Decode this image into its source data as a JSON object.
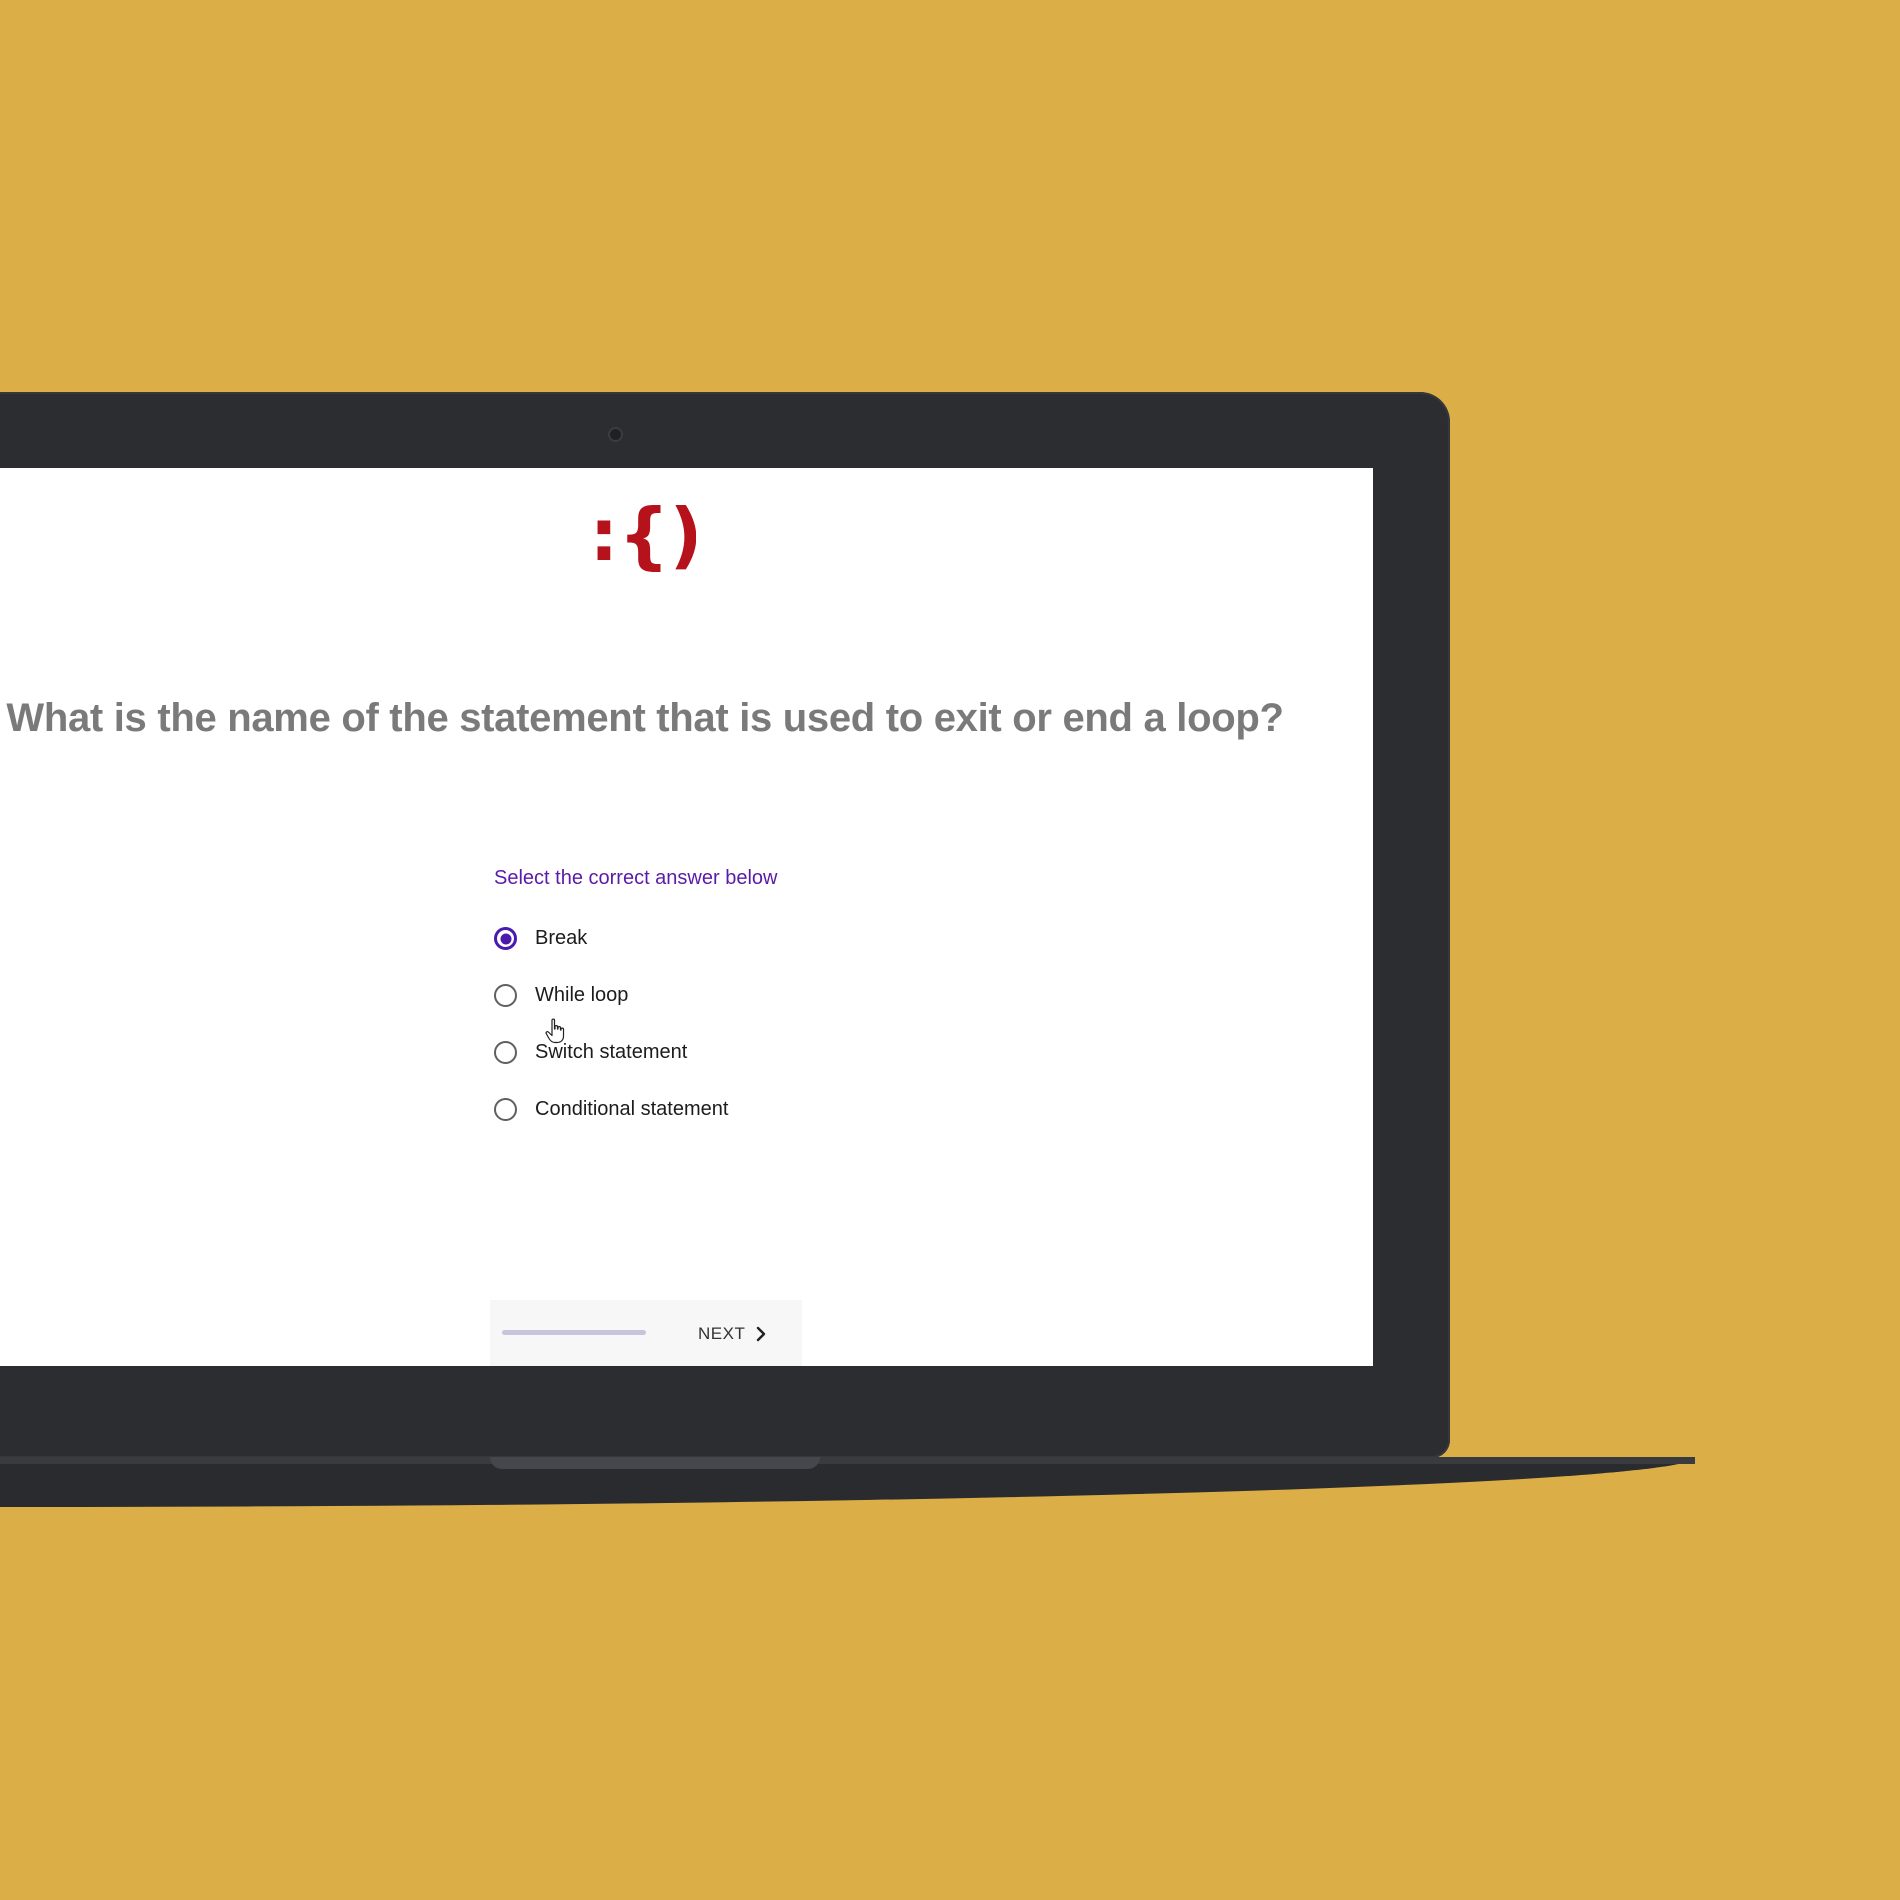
{
  "logo": {
    "text": ":{)",
    "color": "#b5121b"
  },
  "question": {
    "text": "What is the name of the statement that is used to exit or end a loop?"
  },
  "answers": {
    "prompt": "Select the correct answer below",
    "options": [
      {
        "label": "Break",
        "selected": true
      },
      {
        "label": "While loop",
        "selected": false
      },
      {
        "label": "Switch statement",
        "selected": false
      },
      {
        "label": "Conditional statement",
        "selected": false
      }
    ]
  },
  "footer": {
    "next_label": "NEXT"
  },
  "colors": {
    "background": "#DCAE47",
    "accent": "#4a1ab0",
    "prompt": "#5a1ba8",
    "laptop": "#2c2d30"
  },
  "icons": [
    "camera-icon",
    "radio-selected-icon",
    "radio-unselected-icon",
    "hand-cursor-icon",
    "chevron-right-icon"
  ]
}
